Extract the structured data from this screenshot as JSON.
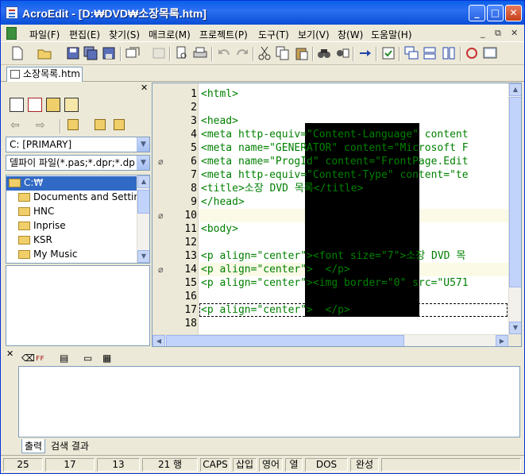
{
  "window": {
    "title": "AcroEdit - [D:₩DVD₩소장목록.htm]"
  },
  "menu": [
    "파일(F)",
    "편집(E)",
    "찾기(S)",
    "매크로(M)",
    "프로젝트(P)",
    "도구(T)",
    "보기(V)",
    "창(W)",
    "도움말(H)"
  ],
  "doc_tab": {
    "label": "소장목록.htm"
  },
  "left_pane": {
    "drive": "C: [PRIMARY]",
    "filter": "델파이 파일(*.pas;*.dpr;*.dp",
    "tree": [
      "C:₩",
      "Documents and Settings",
      "HNC",
      "Inprise",
      "KSR",
      "My Music"
    ]
  },
  "editor": {
    "line_numbers": [
      "1",
      "2",
      "3",
      "4",
      "5",
      "6",
      "7",
      "8",
      "9",
      "10",
      "11",
      "12",
      "13",
      "14",
      "15",
      "16",
      "17",
      "18"
    ],
    "lines": {
      "l1": "<html>",
      "l3": "<head>",
      "l4": "<meta http-equiv=\"Content-Language\" content",
      "l5": "<meta name=\"GENERATOR\" content=\"Microsoft F",
      "l6": "<meta name=\"ProgId\" content=\"FrontPage.Edit",
      "l7": "<meta http-equiv=\"Content-Type\" content=\"te",
      "l8": "<title>소장 DVD 목록</title>",
      "l9": "</head>",
      "l11": "<body>",
      "l13": "<p align=\"center\"><font size=\"7\">소장 DVD 목",
      "l14": "<p align=\"center\">  </p>",
      "l15": "<p align=\"center\"><img border=\"0\" src=\"U571",
      "l17": "<p align=\"center\">  </p>"
    }
  },
  "output": {
    "tabs": [
      "출력",
      "검색 결과"
    ]
  },
  "status": {
    "col1": "25",
    "col2": "17",
    "col3": "13",
    "lines": "21 행",
    "caps": "CAPS",
    "insert": "삽입",
    "lang": "영어",
    "col_mode": "열",
    "eol": "DOS",
    "state": "완성"
  }
}
